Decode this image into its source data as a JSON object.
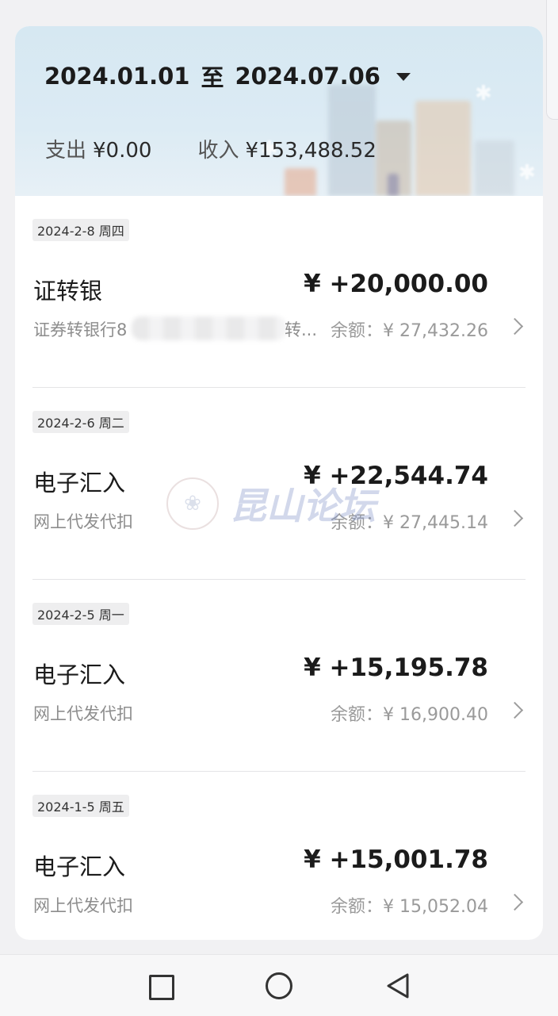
{
  "header": {
    "date_from": "2024.01.01",
    "range_sep": "至",
    "date_to": "2024.07.06",
    "expense_label": "支出",
    "expense_value": "¥0.00",
    "income_label": "收入",
    "income_value": "¥153,488.52"
  },
  "transactions": [
    {
      "date": "2024-2-8 周四",
      "title": "证转银",
      "amount": "¥ +20,000.00",
      "desc": "证券转银行8",
      "desc_tail": "转...",
      "balance": "余额：¥ 27,432.26"
    },
    {
      "date": "2024-2-6 周二",
      "title": "电子汇入",
      "amount": "¥ +22,544.74",
      "desc": "网上代发代扣",
      "balance": "余额：¥ 27,445.14"
    },
    {
      "date": "2024-2-5 周一",
      "title": "电子汇入",
      "amount": "¥ +15,195.78",
      "desc": "网上代发代扣",
      "balance": "余额：¥ 16,900.40"
    },
    {
      "date": "2024-1-5 周五",
      "title": "电子汇入",
      "amount": "¥ +15,001.78",
      "desc": "网上代发代扣",
      "balance": "余额：¥ 15,052.04"
    }
  ],
  "watermark": {
    "text": "昆山论坛"
  },
  "icons": {
    "caret": "caret-down-icon",
    "chevron": "chevron-right-icon",
    "nav_recent": "square-icon",
    "nav_home": "circle-icon",
    "nav_back": "triangle-back-icon"
  },
  "colors": {
    "card_bg": "#ffffff",
    "page_bg": "#f1f1f3",
    "text_primary": "#1b1b1b",
    "text_secondary": "#9a9a9a"
  }
}
